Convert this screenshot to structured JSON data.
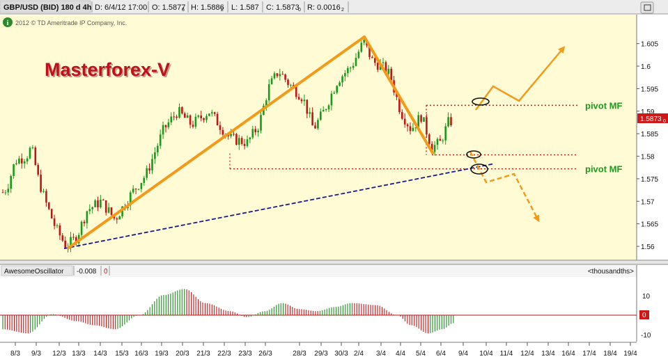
{
  "header": {
    "symbol": "GBP/USD (BID) 180 d 4h",
    "date": "D: 6/4/12 17:00",
    "open": "O: 1.5877",
    "open_sub": "6",
    "high": "H: 1.5886",
    "high_sub": "2",
    "low": "L: 1.587",
    "close": "C: 1.5873",
    "close_sub": "0",
    "range": "R: 0.0016",
    "range_sub": "2"
  },
  "copyright": "2012 © TD Ameritrade IP Company, Inc.",
  "info_badge": "i",
  "watermark": "Masterforex-V",
  "price_label": "1.5873",
  "price_label_sub": "0",
  "colors": {
    "background": "#fefbd5",
    "up_candle": "#1a9a1a",
    "down_candle": "#c41414",
    "annotation": "#f39a1a",
    "trendline": "#1a1a8a",
    "pivot_line": "#d01818",
    "pivot_text": "#1f9a1f",
    "watermark": "#c0101c",
    "oscillator_up": "#1a8a1a",
    "oscillator_down": "#c41414",
    "zero_line": "#b01010"
  },
  "oscillator": {
    "name": "AwesomeOscillator",
    "value": "-0.008",
    "zero_marker": "0",
    "units": "<thousandths>",
    "yticks": [
      "10",
      "-10"
    ],
    "zero_label": "0"
  },
  "pivots": [
    {
      "label": "pivot MF",
      "price": 1.5913
    },
    {
      "label": "pivot MF",
      "price": 1.5772
    }
  ],
  "chart_data": {
    "type": "candlestick",
    "ylim": [
      1.558,
      1.6085
    ],
    "yticks": [
      "1.56",
      "1.565",
      "1.57",
      "1.575",
      "1.58",
      "1.585",
      "1.59",
      "1.595",
      "1.6",
      "1.605"
    ],
    "xlabels": [
      "8/3",
      "9/3",
      "12/3",
      "13/3",
      "14/3",
      "15/3",
      "16/3",
      "19/3",
      "20/3",
      "21/3",
      "22/3",
      "23/3",
      "26/3",
      "28/3",
      "29/3",
      "30/3",
      "2/4",
      "3/4",
      "4/4",
      "5/4",
      "6/4",
      "9/4",
      "10/4",
      "11/4",
      "12/4",
      "13/4",
      "16/4",
      "17/4",
      "18/4",
      "19/4"
    ],
    "last_close": 1.5873,
    "swing_points": [
      {
        "date": "12/3",
        "price": 1.5595
      },
      {
        "date": "2/4",
        "price": 1.6065
      },
      {
        "date": "5/4",
        "price": 1.5805
      }
    ],
    "trendline": [
      {
        "date": "12/3",
        "price": 1.5595
      },
      {
        "date": "9/4",
        "price": 1.5783
      }
    ],
    "pivot_levels": [
      1.5913,
      1.5803,
      1.5772
    ]
  }
}
